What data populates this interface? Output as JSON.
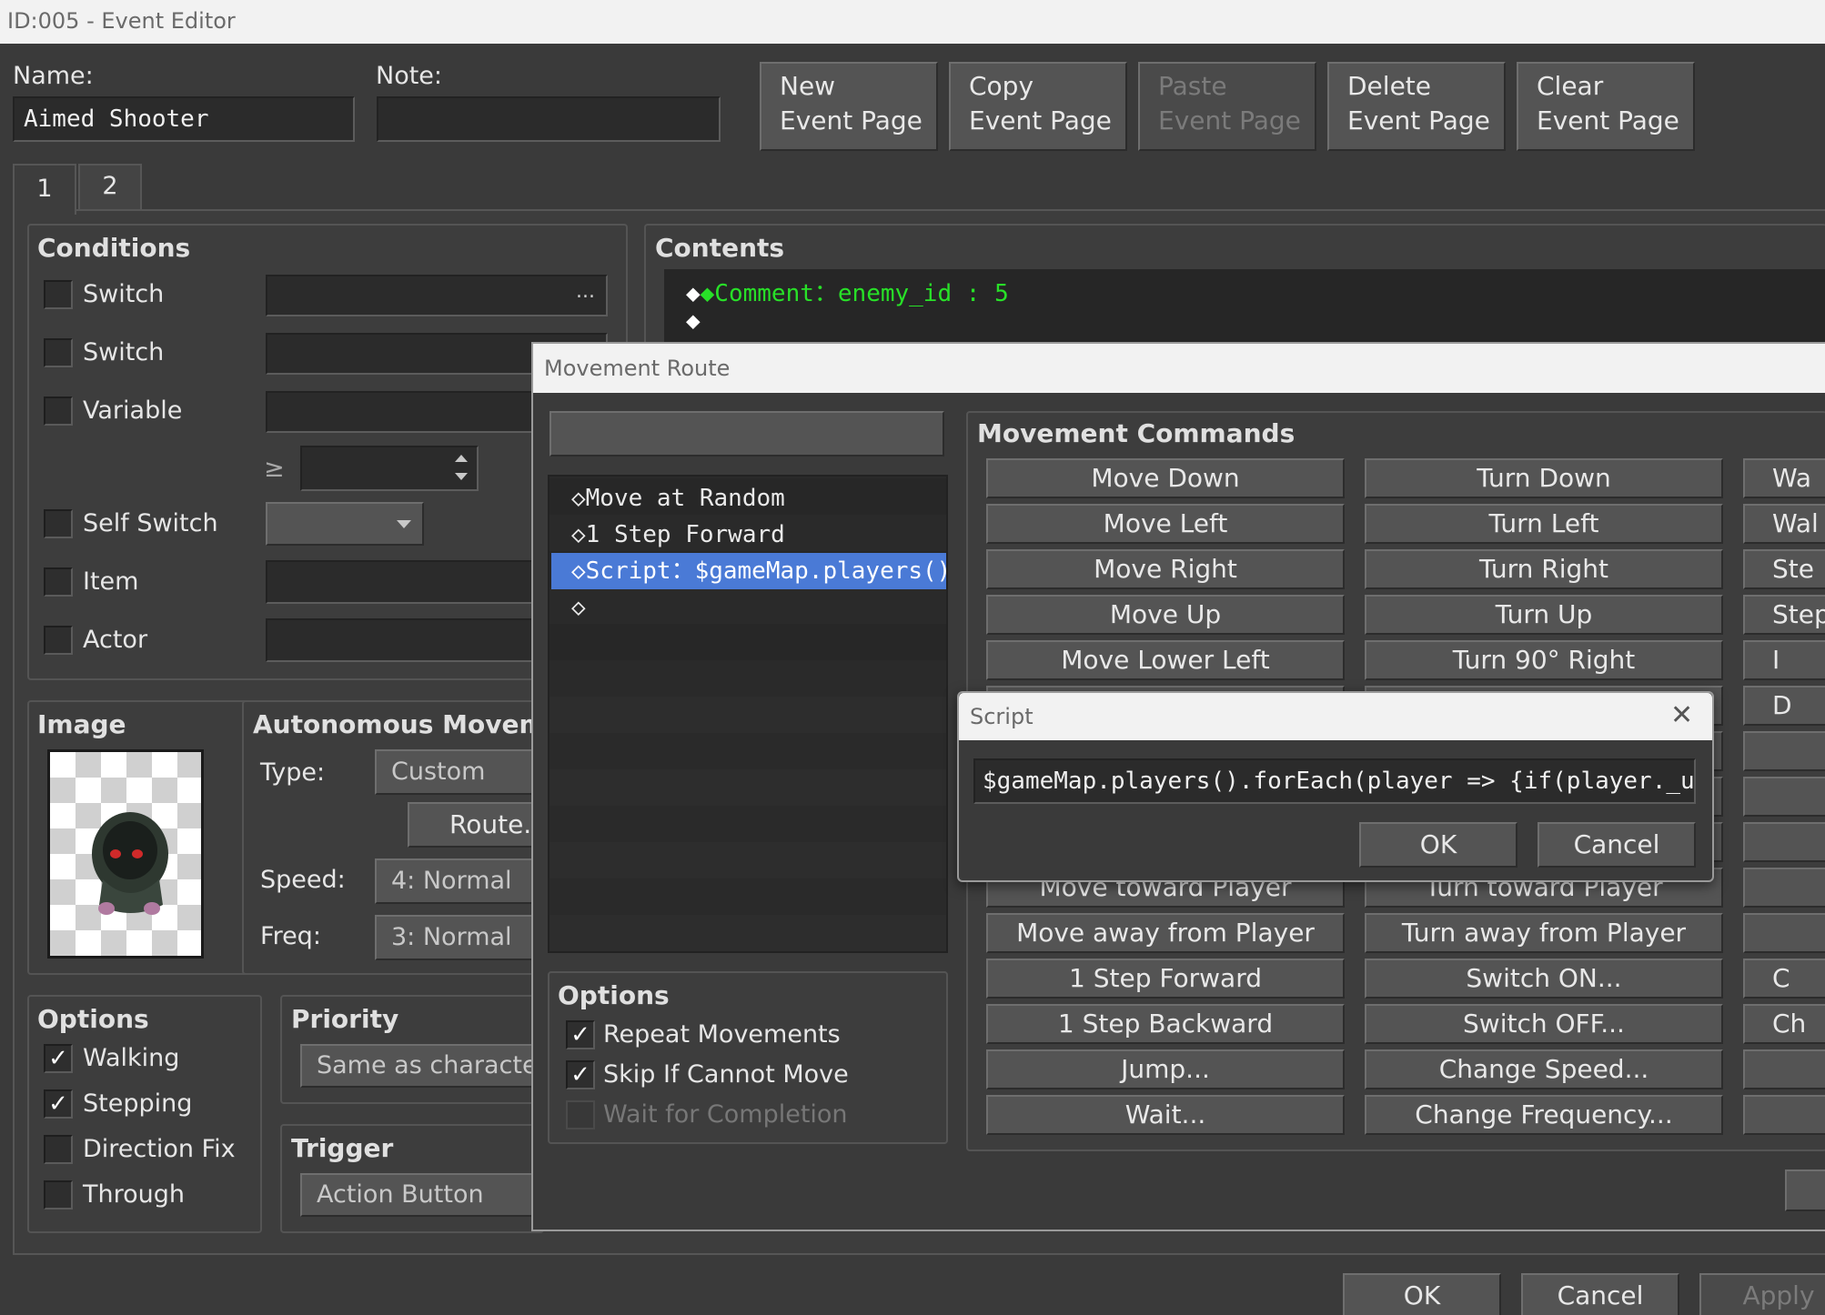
{
  "window": {
    "title": "ID:005 - Event Editor"
  },
  "header": {
    "name_label": "Name:",
    "name_value": "Aimed Shooter",
    "note_label": "Note:",
    "note_value": "",
    "buttons": {
      "new": [
        "New",
        "Event Page"
      ],
      "copy": [
        "Copy",
        "Event Page"
      ],
      "paste": [
        "Paste",
        "Event Page"
      ],
      "delete": [
        "Delete",
        "Event Page"
      ],
      "clear": [
        "Clear",
        "Event Page"
      ]
    }
  },
  "tabs": [
    "1",
    "2"
  ],
  "conditions": {
    "title": "Conditions",
    "switch1": "Switch",
    "switch1_dots": "...",
    "switch2": "Switch",
    "variable": "Variable",
    "gte": "≥",
    "self_switch": "Self Switch",
    "item": "Item",
    "actor": "Actor"
  },
  "image": {
    "title": "Image"
  },
  "autonomous": {
    "title": "Autonomous Movement",
    "type_label": "Type:",
    "type_value": "Custom",
    "route_button": "Route...",
    "speed_label": "Speed:",
    "speed_value": "4: Normal",
    "freq_label": "Freq:",
    "freq_value": "3: Normal"
  },
  "options": {
    "title": "Options",
    "walking": "Walking",
    "stepping": "Stepping",
    "direction_fix": "Direction Fix",
    "through": "Through"
  },
  "priority": {
    "title": "Priority",
    "value": "Same as characters"
  },
  "trigger": {
    "title": "Trigger",
    "value": "Action Button"
  },
  "contents": {
    "title": "Contents",
    "lines": [
      "◆Comment：enemy_id : 5",
      "◆"
    ]
  },
  "movement_route": {
    "title": "Movement Route",
    "target": "",
    "list": [
      "◇Move at Random",
      "◇1 Step Forward",
      "◇Script：$gameMap.players()…",
      "◇"
    ],
    "options_title": "Options",
    "repeat": "Repeat Movements",
    "skip": "Skip If Cannot Move",
    "wait": "Wait for Completion",
    "commands_title": "Movement Commands",
    "col1": [
      "Move Down",
      "Move Left",
      "Move Right",
      "Move Up",
      "Move Lower Left",
      "",
      "",
      "",
      "Move toward Player",
      "Move away from Player",
      "1 Step Forward",
      "1 Step Backward",
      "Jump...",
      "Wait..."
    ],
    "col2": [
      "Turn Down",
      "Turn Left",
      "Turn Right",
      "Turn Up",
      "Turn 90° Right",
      "",
      "",
      "",
      "Turn toward Player",
      "Turn away from Player",
      "Switch ON...",
      "Switch OFF...",
      "Change Speed...",
      "Change Frequency..."
    ],
    "col3": [
      "Wa",
      "Wal",
      "Ste",
      "Step",
      "I",
      "D",
      "",
      "",
      "",
      "",
      "C",
      "Ch",
      "",
      ""
    ]
  },
  "script_dialog": {
    "title": "Script",
    "value": "$gameMap.players().forEach(player => {if(player._user.bat",
    "ok": "OK",
    "cancel": "Cancel"
  },
  "footer": {
    "ok": "OK",
    "cancel": "Cancel",
    "apply": "Apply"
  }
}
